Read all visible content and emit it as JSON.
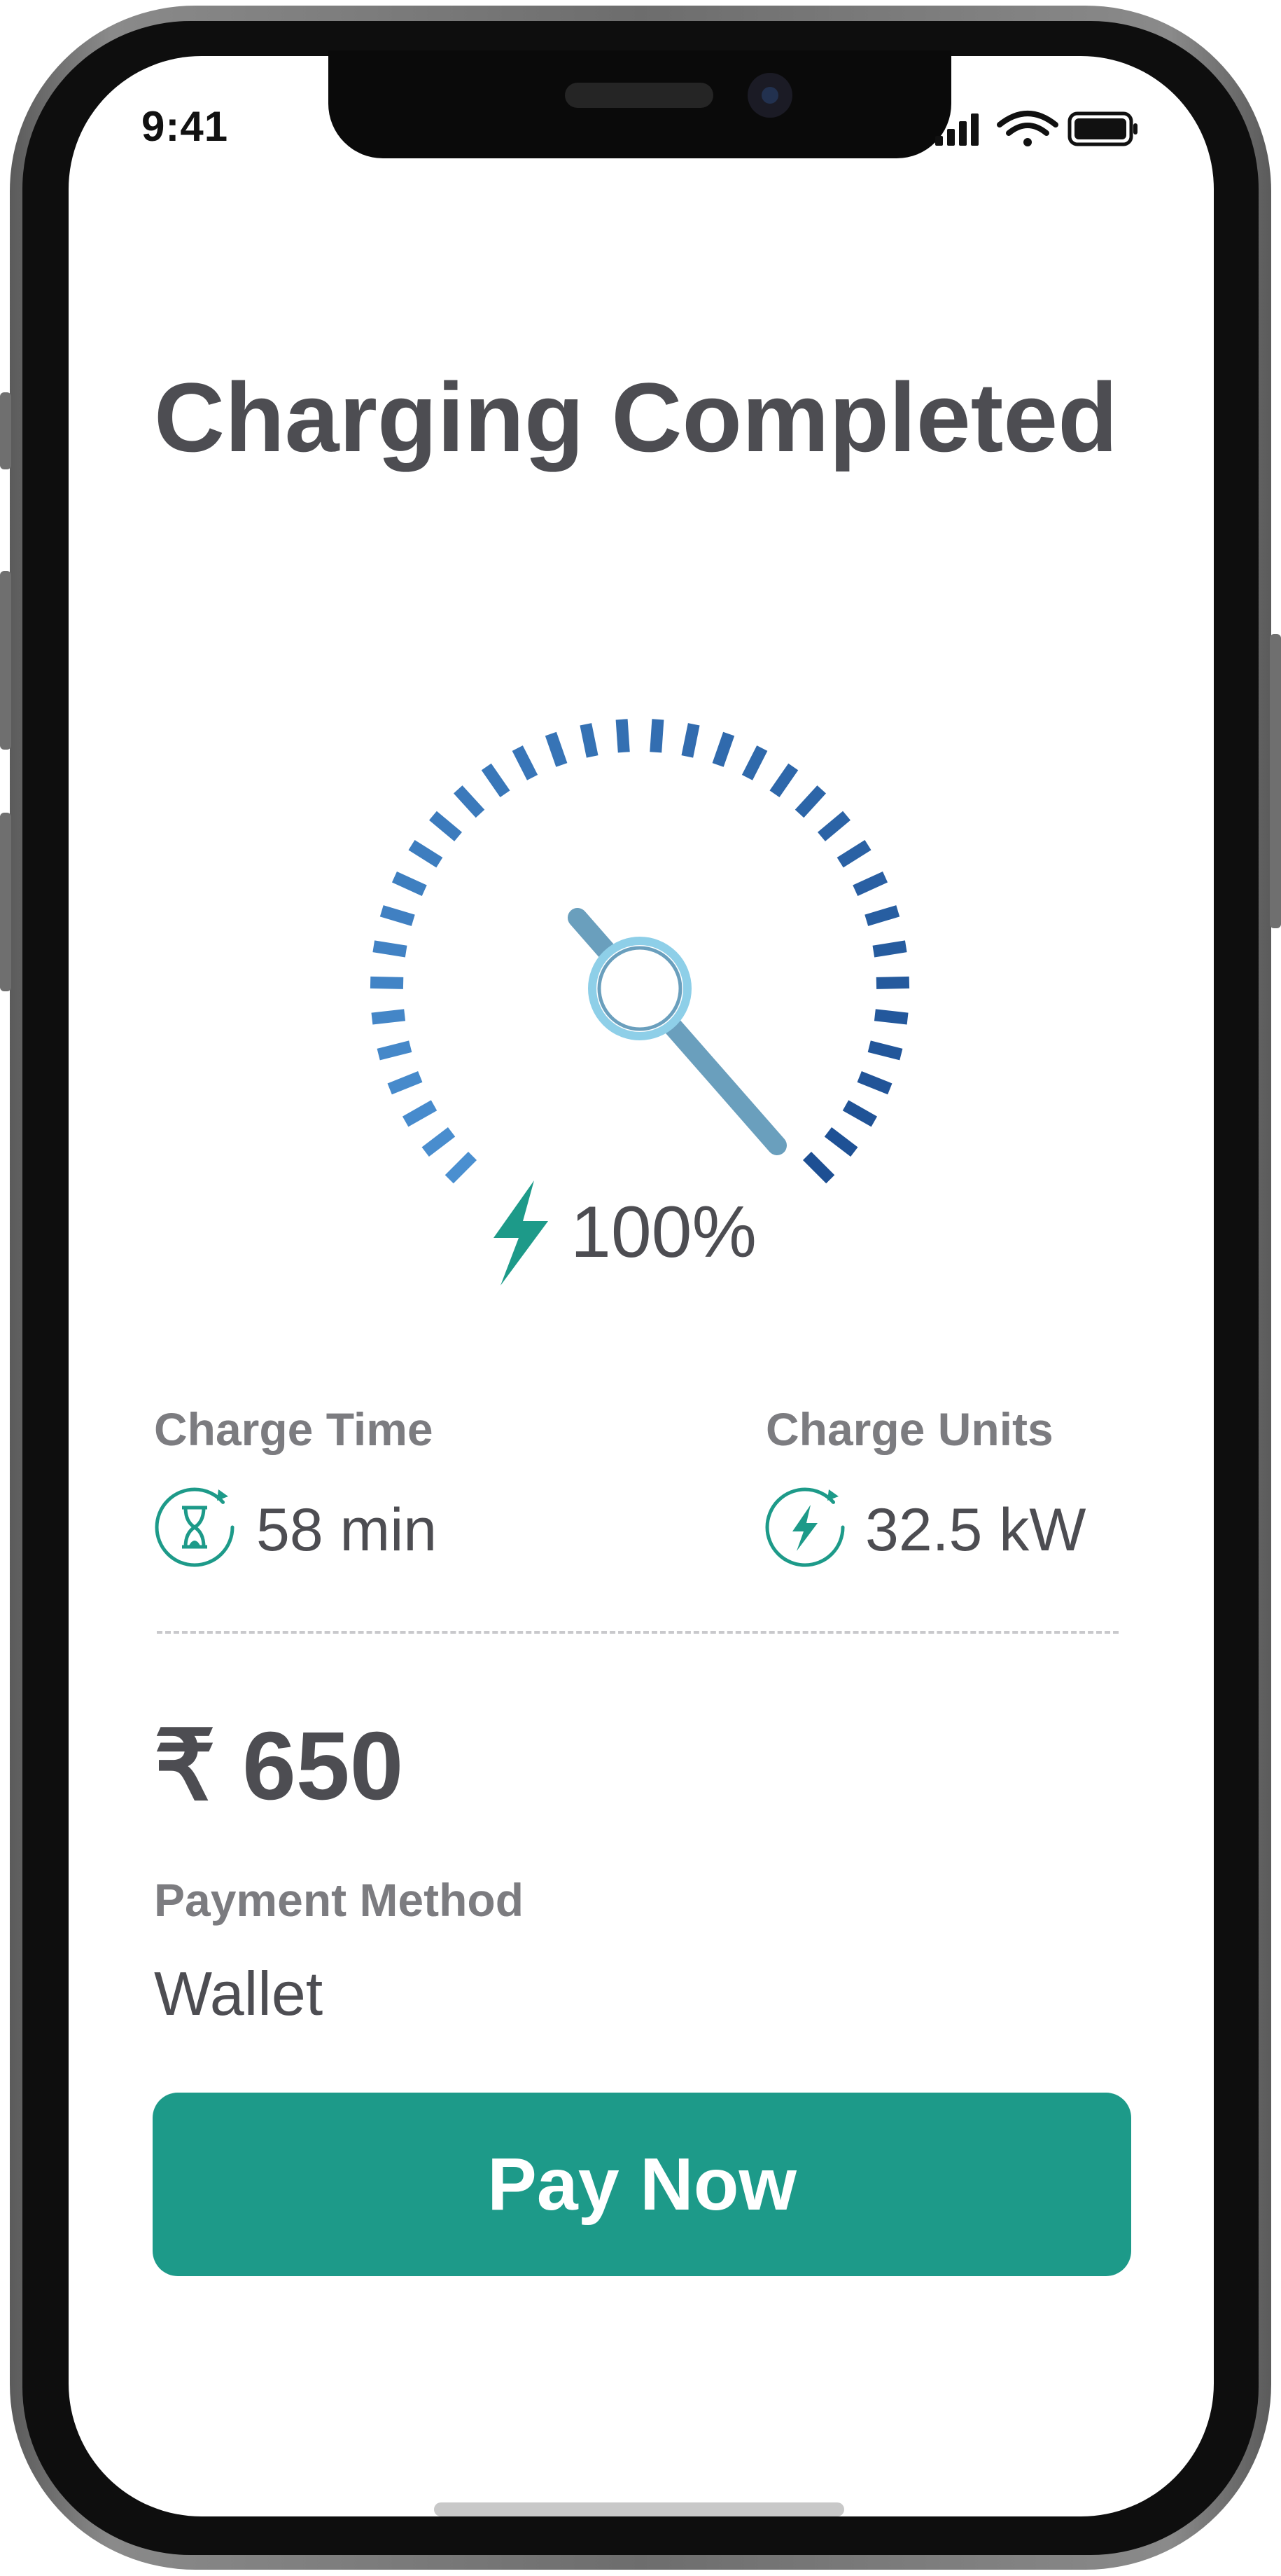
{
  "status_bar": {
    "time": "9:41"
  },
  "title": "Charging Completed",
  "gauge": {
    "percent_label": "100%",
    "level": 1.0
  },
  "stats": {
    "charge_time": {
      "label": "Charge Time",
      "value": "58 min"
    },
    "charge_units": {
      "label": "Charge Units",
      "value": "32.5 kW"
    }
  },
  "amount": "₹ 650",
  "payment": {
    "label": "Payment Method",
    "value": "Wallet"
  },
  "pay_button": {
    "label": "Pay Now"
  },
  "colors": {
    "accent": "#1d9a89",
    "tick_light": "#4a8fd0",
    "tick_dark": "#1d4f93",
    "needle": "#6a9fbd",
    "text_dark": "#4d4d52",
    "text_muted": "#7c7c80"
  },
  "icons": {
    "gauge": "bolt-icon",
    "charge_time": "hourglass-icon",
    "charge_units": "bolt-circle-icon"
  }
}
